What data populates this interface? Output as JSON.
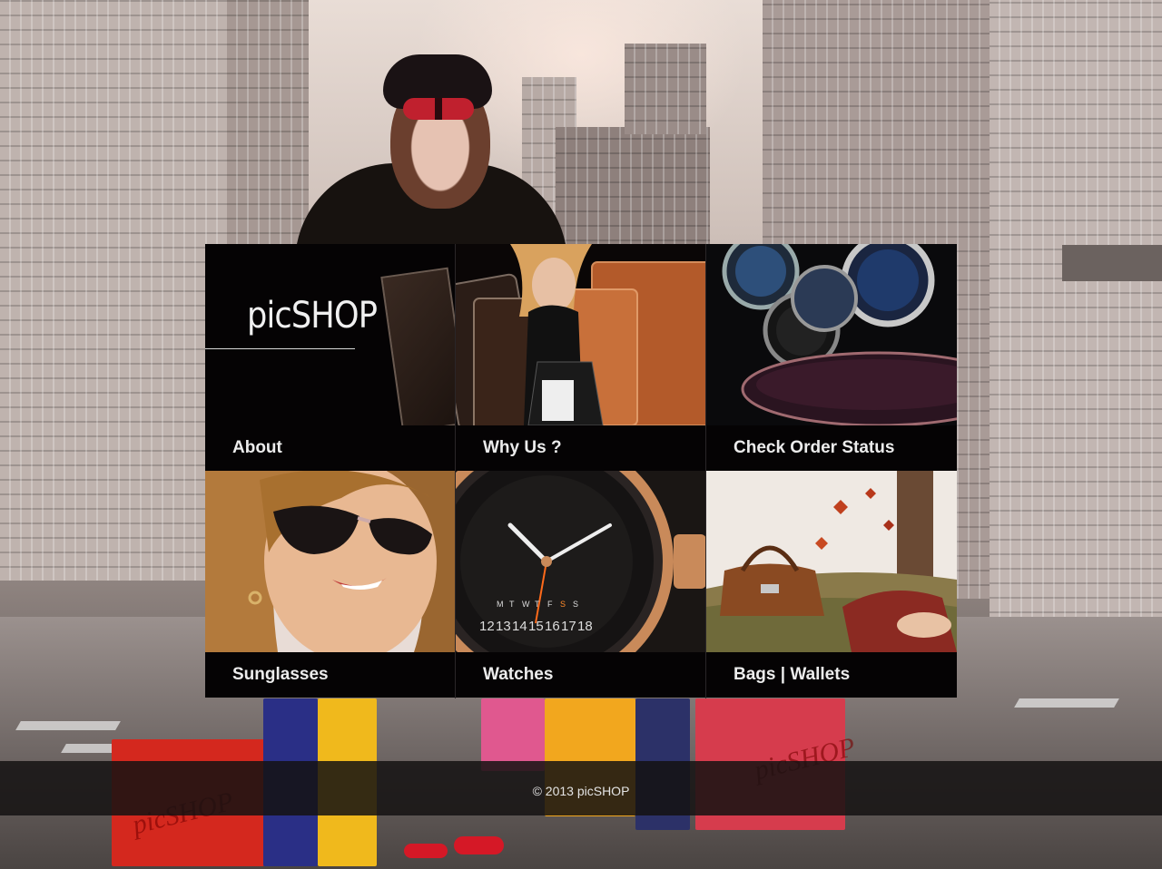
{
  "brand": {
    "logo_text": "picSHOP"
  },
  "tiles": [
    {
      "label": "About"
    },
    {
      "label": "Why Us ?"
    },
    {
      "label": "Check Order Status"
    },
    {
      "label": "Sunglasses"
    },
    {
      "label": "Watches"
    },
    {
      "label": "Bags | Wallets"
    }
  ],
  "footer": {
    "copyright": "© 2013 picSHOP"
  },
  "background": {
    "bag_brand_left": "picSHOP",
    "bag_brand_right": "picSHOP"
  },
  "watch_dial": {
    "numbers": [
      "12",
      "13",
      "14",
      "15",
      "16",
      "17",
      "18"
    ],
    "days": [
      "M",
      "T",
      "W",
      "T",
      "F",
      "S",
      "S"
    ]
  },
  "colors": {
    "tile_label_bg": "#050304",
    "tile_label_text": "#ececec",
    "footer_bg": "#141212",
    "accent_red": "#c0202e"
  }
}
